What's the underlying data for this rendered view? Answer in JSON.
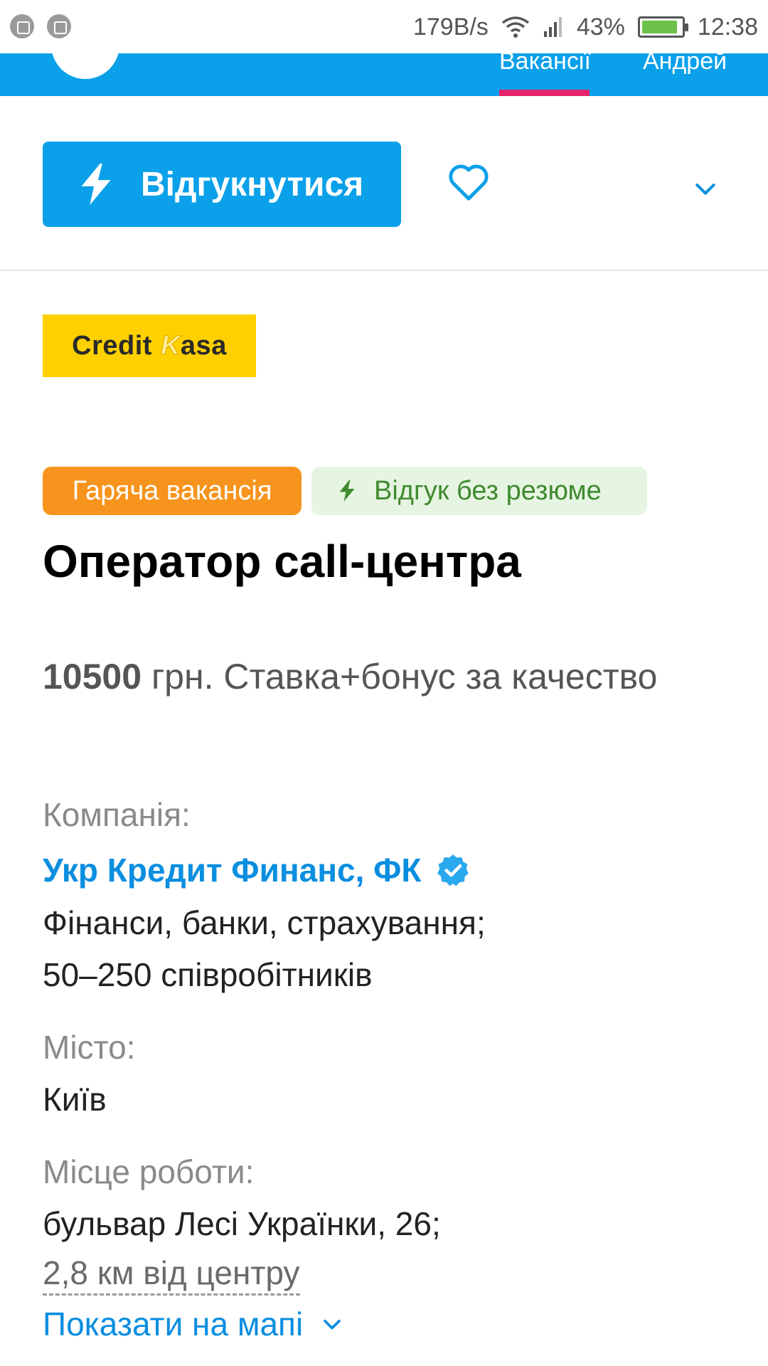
{
  "status_bar": {
    "speed": "179B/s",
    "battery_percent": "43%",
    "battery_level": 0.9,
    "time": "12:38"
  },
  "nav": {
    "tab_vacancies": "Вакансії",
    "tab_user": "Андрей",
    "active_underline_color": "#e5226b",
    "bar_color": "#0aa0ea"
  },
  "actions": {
    "apply_label": "Відгукнутися",
    "apply_icon": "lightning-icon",
    "favorite_icon": "heart-outline-icon",
    "more_icon": "chevron-down-icon"
  },
  "logo": {
    "text_main": "Credit",
    "text_k": "K",
    "text_rest": "asa",
    "bg_color": "#ffd000"
  },
  "badges": {
    "hot": "Гаряча вакансія",
    "no_resume": "Відгук без резюме"
  },
  "job": {
    "title": "Оператор call-центра",
    "salary_amount": "10500",
    "salary_rest": " грн. Ставка+бонус за качество"
  },
  "company": {
    "label": "Компанія:",
    "name": "Укр Кредит Финанс, ФК",
    "industry": "Фінанси, банки, страхування;",
    "size": "50–250 співробітників"
  },
  "city": {
    "label": "Місто:",
    "value": "Київ"
  },
  "workplace": {
    "label": "Місце роботи:",
    "address": "бульвар Лесі Українки, 26;",
    "distance": "2,8 км від центру",
    "map_link": "Показати на мапі"
  }
}
